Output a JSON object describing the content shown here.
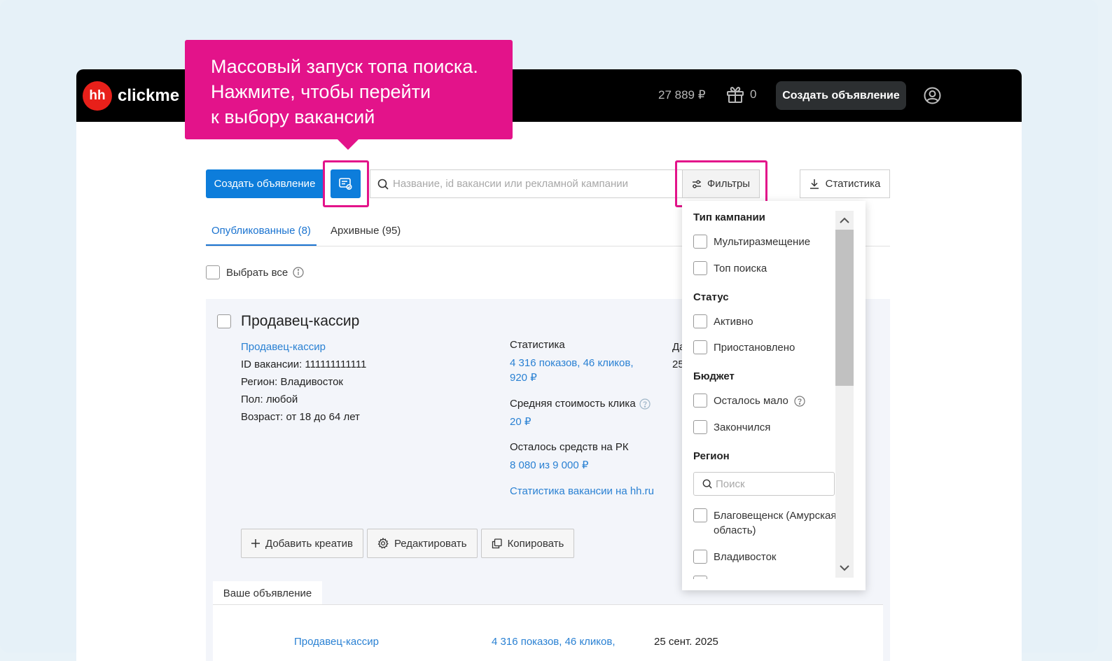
{
  "header": {
    "logo_badge": "hh",
    "logo_text": "clickme",
    "balance": "27 889 ₽",
    "gifts_count": "0",
    "create_button": "Создать объявление"
  },
  "tooltip": {
    "lines": [
      "Массовый запуск топа поиска.",
      "Нажмите, чтобы перейти",
      "к выбору вакансий"
    ]
  },
  "toolbar": {
    "create_button": "Создать объявление",
    "search_placeholder": "Название, id вакансии или рекламной кампании",
    "filters_button": "Фильтры",
    "stats_button": "Статистика"
  },
  "tabs": {
    "published": "Опубликованные (8)",
    "archive": "Архивные (95)"
  },
  "select_all": "Выбрать все",
  "card": {
    "title": "Продавец-кассир",
    "vacancy_link": "Продавец-кассир",
    "id_line": "ID вакансии: 111111111111",
    "region_line": "Регион: Владивосток",
    "gender_line": "Пол: любой",
    "age_line": "Возраст: от 18 до 64 лет",
    "stats_label": "Статистика",
    "stats_value_1": "4 316 показов, 46 кликов,",
    "stats_value_2": "920 ₽",
    "cpc_label": "Средняя стоимость клика",
    "cpc_value": "20 ₽",
    "funds_label": "Осталось средств на РК",
    "funds_value": "8 080 из 9 000 ₽",
    "hh_stats_link": "Статистика вакансии на hh.ru",
    "col3_label": "Да",
    "col3_value": "25",
    "actions": {
      "add_creative": "Добавить креатив",
      "edit": "Редактировать",
      "copy": "Копировать"
    },
    "subtab": "Ваше объявление",
    "bottom": {
      "vacancy": "Продавец-кассир",
      "stats": "4 316 показов, 46 кликов,",
      "date": "25 сент. 2025"
    }
  },
  "filters": {
    "campaign_type_title": "Тип кампании",
    "campaign_types": [
      "Мультиразмещение",
      "Топ поиска"
    ],
    "status_title": "Статус",
    "statuses": [
      "Активно",
      "Приостановлено"
    ],
    "budget_title": "Бюджет",
    "budgets": [
      "Осталось мало",
      "Закончился"
    ],
    "region_title": "Регион",
    "region_search_placeholder": "Поиск",
    "regions": [
      "Благовещенск (Амурская область)",
      "Владивосток"
    ]
  },
  "colors": {
    "accent": "#e3138a",
    "primary": "#0d7ddb",
    "link": "#2a81d3",
    "brand_red": "#e8201a"
  }
}
